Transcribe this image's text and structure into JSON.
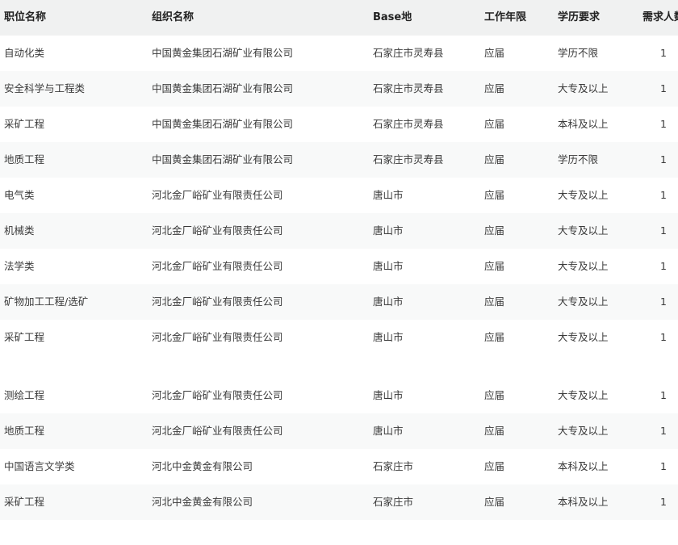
{
  "table": {
    "headers": [
      "职位名称",
      "组织名称",
      "Base地",
      "工作年限",
      "学历要求",
      "需求人数"
    ],
    "rows": [
      [
        "自动化类",
        "中国黄金集团石湖矿业有限公司",
        "石家庄市灵寿县",
        "应届",
        "学历不限",
        "1"
      ],
      [
        "安全科学与工程类",
        "中国黄金集团石湖矿业有限公司",
        "石家庄市灵寿县",
        "应届",
        "大专及以上",
        "1"
      ],
      [
        "采矿工程",
        "中国黄金集团石湖矿业有限公司",
        "石家庄市灵寿县",
        "应届",
        "本科及以上",
        "1"
      ],
      [
        "地质工程",
        "中国黄金集团石湖矿业有限公司",
        "石家庄市灵寿县",
        "应届",
        "学历不限",
        "1"
      ],
      [
        "电气类",
        "河北金厂峪矿业有限责任公司",
        "唐山市",
        "应届",
        "大专及以上",
        "1"
      ],
      [
        "机械类",
        "河北金厂峪矿业有限责任公司",
        "唐山市",
        "应届",
        "大专及以上",
        "1"
      ],
      [
        "法学类",
        "河北金厂峪矿业有限责任公司",
        "唐山市",
        "应届",
        "大专及以上",
        "1"
      ],
      [
        "矿物加工工程/选矿",
        "河北金厂峪矿业有限责任公司",
        "唐山市",
        "应届",
        "大专及以上",
        "1"
      ],
      [
        "采矿工程",
        "河北金厂峪矿业有限责任公司",
        "唐山市",
        "应届",
        "大专及以上",
        "1"
      ]
    ],
    "rows_after_gap": [
      [
        "测绘工程",
        "河北金厂峪矿业有限责任公司",
        "唐山市",
        "应届",
        "大专及以上",
        "1"
      ],
      [
        "地质工程",
        "河北金厂峪矿业有限责任公司",
        "唐山市",
        "应届",
        "大专及以上",
        "1"
      ],
      [
        "中国语言文学类",
        "河北中金黄金有限公司",
        "石家庄市",
        "应届",
        "本科及以上",
        "1"
      ],
      [
        "采矿工程",
        "河北中金黄金有限公司",
        "石家庄市",
        "应届",
        "本科及以上",
        "1"
      ]
    ]
  },
  "colors": {
    "header_bg": "#f0f1f1",
    "alt_row_bg": "#f8f9f9",
    "text": "#3a3a3a"
  }
}
